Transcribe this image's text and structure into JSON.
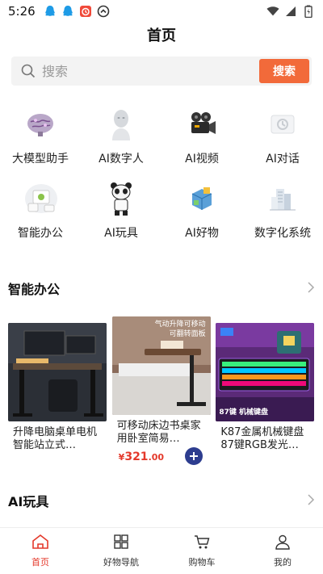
{
  "status_bar": {
    "time": "5:26"
  },
  "header": {
    "title": "首页"
  },
  "search": {
    "placeholder": "搜索",
    "button_label": "搜索"
  },
  "categories": [
    {
      "label": "大模型助手",
      "icon": "brain-icon"
    },
    {
      "label": "AI数字人",
      "icon": "digital-human-icon"
    },
    {
      "label": "AI视频",
      "icon": "video-camera-icon"
    },
    {
      "label": "AI对话",
      "icon": "chat-icon"
    },
    {
      "label": "智能办公",
      "icon": "smart-office-icon"
    },
    {
      "label": "AI玩具",
      "icon": "toy-robot-icon"
    },
    {
      "label": "AI好物",
      "icon": "goods-icon"
    },
    {
      "label": "数字化系统",
      "icon": "digital-system-icon"
    }
  ],
  "sections": {
    "office": {
      "title": "智能办公"
    },
    "toys": {
      "title": "AI玩具"
    }
  },
  "products": [
    {
      "name": "升降电脑桌单电机智能站立式…",
      "price": ""
    },
    {
      "name": "可移动床边书桌家用卧室简易…",
      "price_symbol": "¥",
      "price_int": "321",
      "price_frac": ".00",
      "badge_line1": "气动升降可移动",
      "badge_line2": "可翻转面板"
    },
    {
      "name": "K87金属机械键盘87键RGB发光…",
      "price": "",
      "banner": "87键 机械键盘"
    }
  ],
  "tabs": [
    {
      "label": "首页",
      "icon": "home-icon",
      "active": true
    },
    {
      "label": "好物导航",
      "icon": "grid-icon",
      "active": false
    },
    {
      "label": "购物车",
      "icon": "cart-icon",
      "active": false
    },
    {
      "label": "我的",
      "icon": "user-icon",
      "active": false
    }
  ],
  "colors": {
    "accent": "#f26a3a",
    "price": "#e4392b",
    "add_button": "#2d3d8f"
  }
}
